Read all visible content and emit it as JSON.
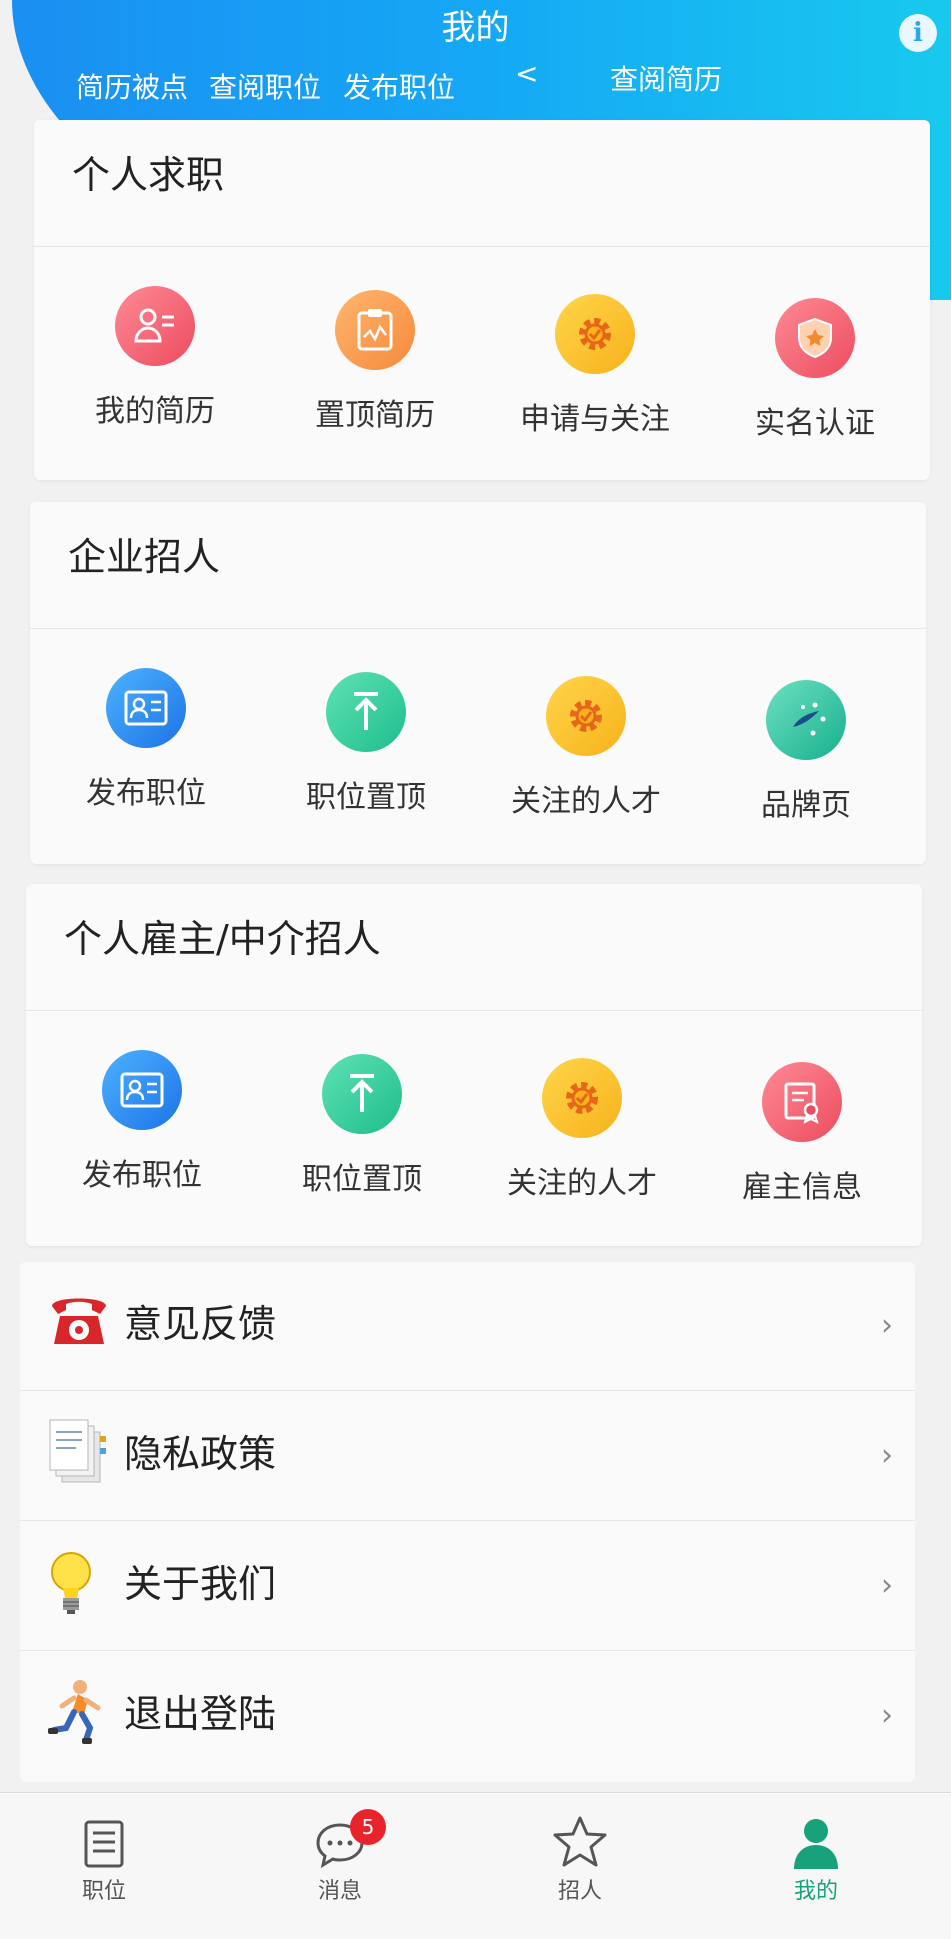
{
  "header": {
    "title": "我的",
    "info_icon": "i",
    "links": [
      "简历被点",
      "查阅职位",
      "发布职位",
      "<",
      "查阅简历"
    ]
  },
  "sections": [
    {
      "title": "个人求职",
      "items": [
        {
          "label": "我的简历",
          "icon": "resume-icon",
          "color": "#ec4c5f"
        },
        {
          "label": "置顶简历",
          "icon": "clipboard-chart-icon",
          "color": "#f58a3c"
        },
        {
          "label": "申请与关注",
          "icon": "gear-check-icon",
          "color": "#f7b21c"
        },
        {
          "label": "实名认证",
          "icon": "shield-icon",
          "color": "#ec4c5f"
        }
      ]
    },
    {
      "title": "企业招人",
      "items": [
        {
          "label": "发布职位",
          "icon": "id-card-icon",
          "color": "#1c73e6"
        },
        {
          "label": "职位置顶",
          "icon": "arrow-top-icon",
          "color": "#1ebd8d"
        },
        {
          "label": "关注的人才",
          "icon": "gear-check-icon",
          "color": "#f7b21c"
        },
        {
          "label": "品牌页",
          "icon": "sparkle-icon",
          "color": "#17b08d"
        }
      ]
    },
    {
      "title": "个人雇主/中介招人",
      "items": [
        {
          "label": "发布职位",
          "icon": "id-card-icon",
          "color": "#1c73e6"
        },
        {
          "label": "职位置顶",
          "icon": "arrow-top-icon",
          "color": "#1ebd8d"
        },
        {
          "label": "关注的人才",
          "icon": "gear-check-icon",
          "color": "#f7b21c"
        },
        {
          "label": "雇主信息",
          "icon": "certificate-icon",
          "color": "#ec4c5f"
        }
      ]
    }
  ],
  "menu": [
    {
      "label": "意见反馈",
      "icon": "telephone-icon"
    },
    {
      "label": "隐私政策",
      "icon": "documents-icon"
    },
    {
      "label": "关于我们",
      "icon": "lightbulb-icon"
    },
    {
      "label": "退出登陆",
      "icon": "runner-icon"
    }
  ],
  "menu_chevron": "›",
  "tabbar": [
    {
      "label": "职位",
      "icon": "document-icon",
      "active": false
    },
    {
      "label": "消息",
      "icon": "chat-bubble-icon",
      "active": false,
      "badge": "5"
    },
    {
      "label": "招人",
      "icon": "star-icon",
      "active": false
    },
    {
      "label": "我的",
      "icon": "person-icon",
      "active": true
    }
  ],
  "colors": {
    "header_start": "#1a8ff2",
    "header_end": "#18c9ee",
    "active_tab": "#17a27c",
    "badge": "#e8232b"
  }
}
